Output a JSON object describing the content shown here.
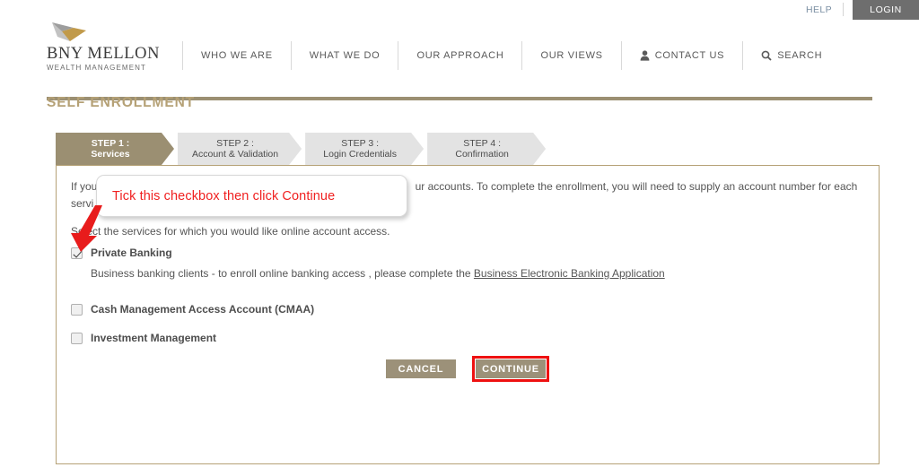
{
  "utility": {
    "help_label": "HELP",
    "login_label": "LOGIN"
  },
  "brand": {
    "name": "BNY MELLON",
    "tagline": "WEALTH MANAGEMENT",
    "logo_icon": "arrow-mark-icon"
  },
  "nav": {
    "items": [
      {
        "label": "WHO WE ARE",
        "icon": ""
      },
      {
        "label": "WHAT WE DO",
        "icon": ""
      },
      {
        "label": "OUR APPROACH",
        "icon": ""
      },
      {
        "label": "OUR VIEWS",
        "icon": ""
      },
      {
        "label": "CONTACT US",
        "icon": "person-icon"
      },
      {
        "label": "SEARCH",
        "icon": "search-icon"
      }
    ]
  },
  "page": {
    "title": "SELF ENROLLMENT"
  },
  "steps": [
    {
      "line1": "STEP 1 :",
      "line2": "Services",
      "active": true
    },
    {
      "line1": "STEP 2 :",
      "line2": "Account & Validation",
      "active": false
    },
    {
      "line1": "STEP 3 :",
      "line2": "Login Credentials",
      "active": false
    },
    {
      "line1": "STEP 4 :",
      "line2": "Confirmation",
      "active": false
    }
  ],
  "content": {
    "intro_line1_visible_start": "If you",
    "intro_line1_visible_end": "ur accounts. To complete the enrollment, you will need to supply an account number for each",
    "intro_line2_visible_start": "servi",
    "select_instruction": "Select the services for which you would like online account access.",
    "services": [
      {
        "label": "Private Banking",
        "checked": true
      },
      {
        "label": "Cash Management Access Account (CMAA)",
        "checked": false
      },
      {
        "label": "Investment Management",
        "checked": false
      }
    ],
    "business_note_prefix": "Business banking clients - to enroll online banking access , please complete the ",
    "business_note_link": "Business Electronic Banking Application"
  },
  "buttons": {
    "cancel": "CANCEL",
    "continue": "CONTINUE"
  },
  "annotation": {
    "callout_text": "Tick this checkbox then click Continue",
    "callout_color": "#f02020",
    "arrow_color": "#e81c1c",
    "highlight_color": "#ee1111"
  },
  "colors": {
    "brand_tan": "#b5a176",
    "active_tab": "#9b8f72",
    "button_bg": "#9c9179",
    "inactive_tab": "#e3e3e3",
    "login_bg": "#6e6e6e"
  }
}
